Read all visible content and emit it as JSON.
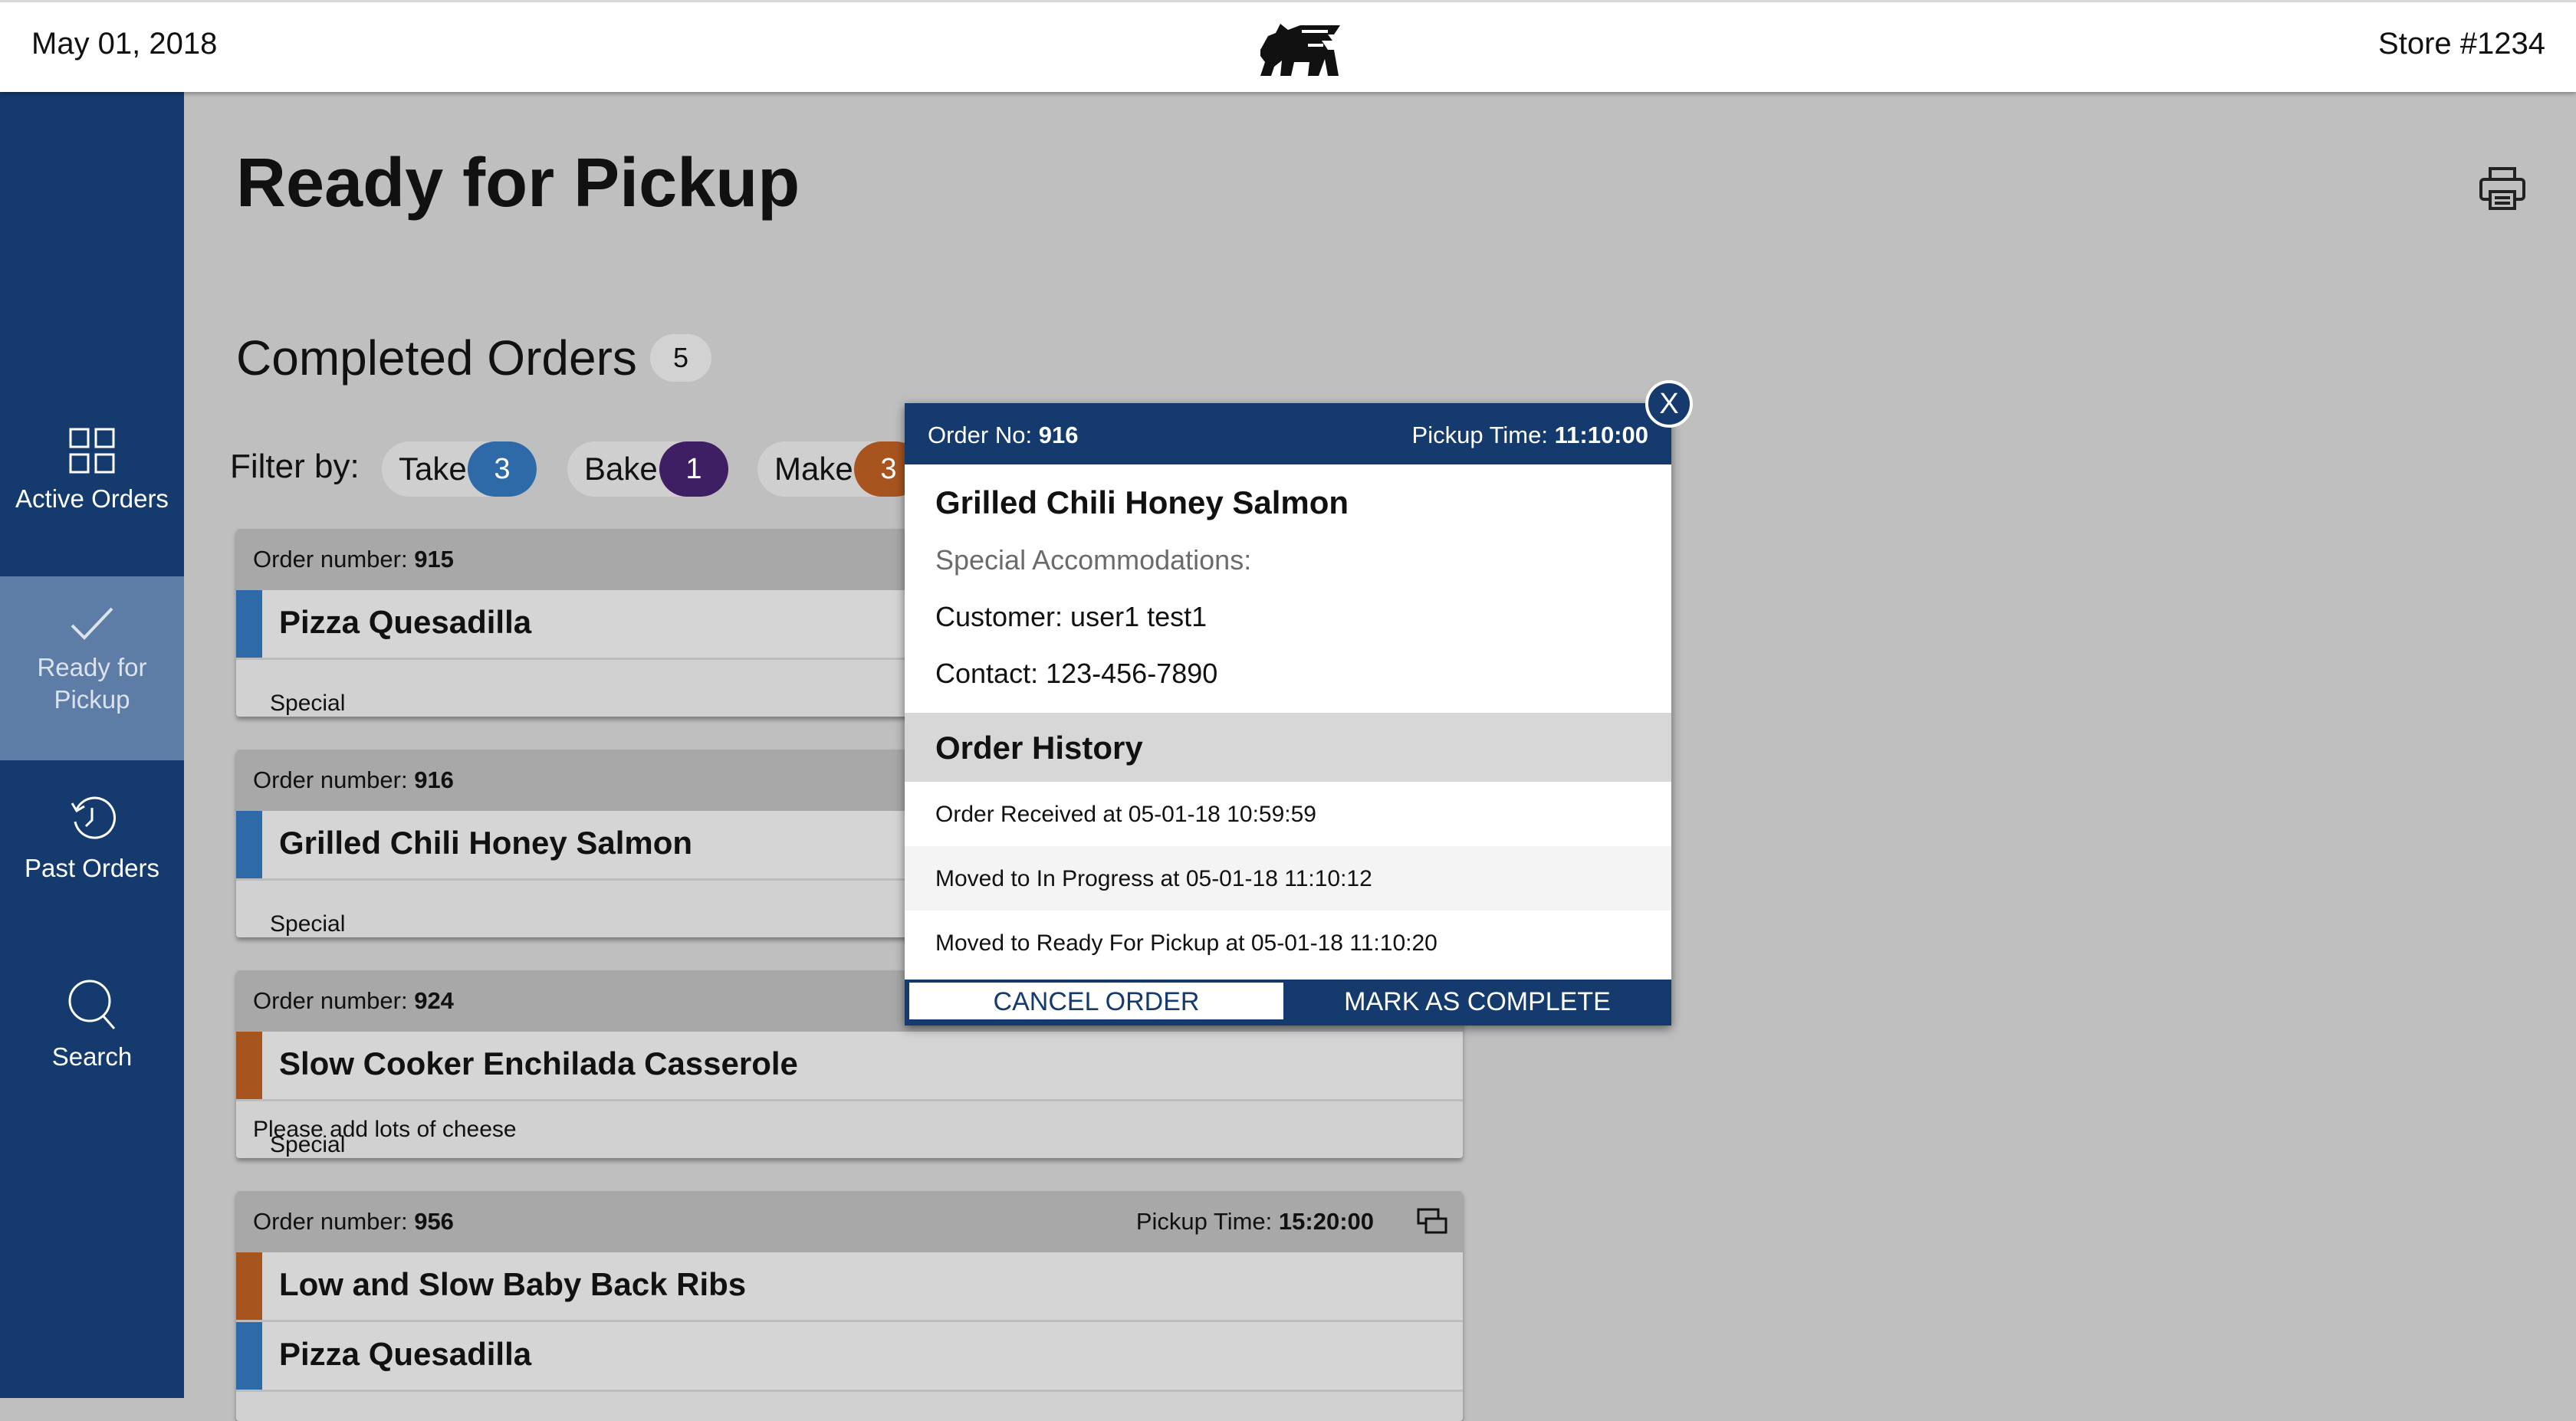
{
  "header": {
    "date": "May 01, 2018",
    "store": "Store #1234",
    "logo_icon": "lion-logo-icon"
  },
  "sidebar": {
    "items": [
      {
        "label": "Active Orders",
        "icon": "grid-icon"
      },
      {
        "label": "Ready for Pickup",
        "icon": "check-icon",
        "active": true
      },
      {
        "label": "Past Orders",
        "icon": "history-icon"
      },
      {
        "label": "Search",
        "icon": "search-icon"
      }
    ]
  },
  "page": {
    "title": "Ready for Pickup",
    "section_title": "Completed Orders",
    "count": "5",
    "filter_label": "Filter by:",
    "filters": [
      {
        "label": "Take",
        "count": "3",
        "color": "#2f6aa8"
      },
      {
        "label": "Bake",
        "count": "1",
        "color": "#3e1f63"
      },
      {
        "label": "Make",
        "count": "3",
        "color": "#a8541f"
      }
    ]
  },
  "orders": [
    {
      "number_label": "Order number:",
      "number": "915",
      "items": [
        {
          "name": "Pizza Quesadilla",
          "color": "#2f6aa8"
        }
      ],
      "notes_label": "Special Accommodations:",
      "notes": ""
    },
    {
      "number_label": "Order number:",
      "number": "916",
      "items": [
        {
          "name": "Grilled Chili Honey Salmon",
          "color": "#2f6aa8"
        }
      ],
      "notes_label": "Special Accommodations:",
      "notes": ""
    },
    {
      "number_label": "Order number:",
      "number": "924",
      "items": [
        {
          "name": "Slow Cooker Enchilada Casserole",
          "color": "#a8541f"
        }
      ],
      "notes_label": "Special Accommodations:",
      "notes": "Please add lots of cheese"
    },
    {
      "number_label": "Order number:",
      "number": "956",
      "pickup_label": "Pickup Time:",
      "pickup_time": "15:20:00",
      "items": [
        {
          "name": "Low and Slow Baby Back Ribs",
          "color": "#a8541f"
        },
        {
          "name": "Pizza Quesadilla",
          "color": "#2f6aa8"
        }
      ]
    }
  ],
  "modal": {
    "order_label": "Order No:",
    "order_number": "916",
    "pickup_label": "Pickup Time:",
    "pickup_time": "11:10:00",
    "title": "Grilled Chili Honey Salmon",
    "accommodations": "Special Accommodations:",
    "customer": "Customer: user1 test1",
    "contact": "Contact: 123-456-7890",
    "history_title": "Order History",
    "history": [
      "Order Received at 05-01-18 10:59:59",
      "Moved to In Progress at 05-01-18 11:10:12",
      "Moved to Ready For Pickup at 05-01-18 11:10:20"
    ],
    "cancel_label": "CANCEL ORDER",
    "complete_label": "MARK AS COMPLETE",
    "close_label": "X"
  }
}
